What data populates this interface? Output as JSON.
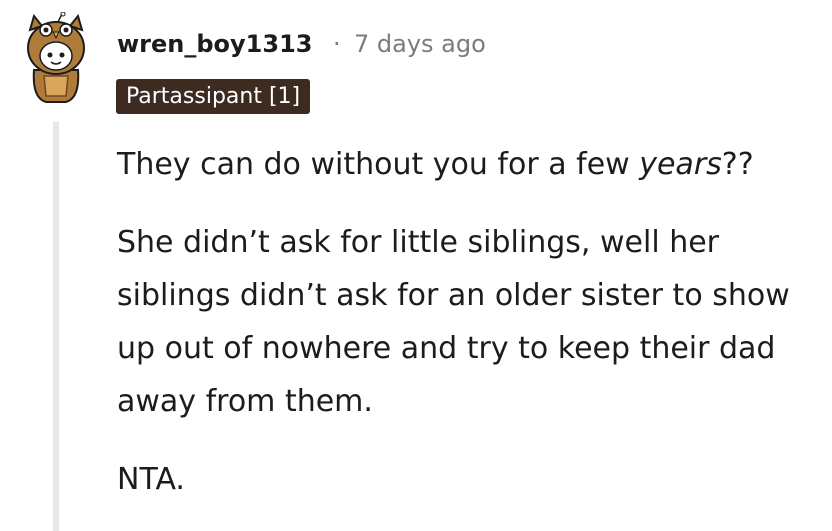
{
  "comment": {
    "username": "wren_boy1313",
    "separator": "·",
    "timestamp": "7 days ago",
    "flair": "Partassipant [1]",
    "paragraph1": {
      "before": "They can do without you for a few ",
      "emphasis": "years",
      "after": "??"
    },
    "paragraph2": "She didn’t ask for little siblings, well her siblings didn’t ask for an older sister to show up out of nowhere and try to keep their dad away from them.",
    "paragraph3": "NTA."
  },
  "avatar": {
    "icon": "owl-snoo-avatar-icon",
    "colors": {
      "costume": "#b07a3a",
      "costume_dark": "#6e4a22",
      "face": "#ffffff",
      "outline": "#1c1c1c"
    }
  },
  "colors": {
    "text": "#1c1c1c",
    "muted": "#7c7c7c",
    "flair_bg": "#3d2b22",
    "flair_text": "#ffffff",
    "thread_line": "#e8e8e8"
  }
}
